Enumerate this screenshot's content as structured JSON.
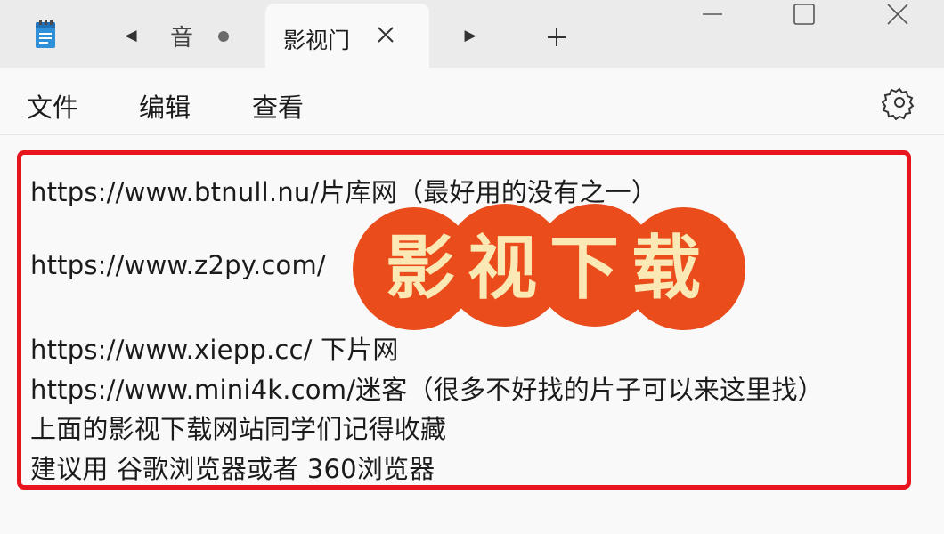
{
  "tabs": {
    "inactive_label": "音",
    "active_label": "影视门"
  },
  "menu": {
    "file": "文件",
    "edit": "编辑",
    "view": "查看"
  },
  "content": {
    "lines": [
      "https://www.btnull.nu/片库网（最好用的没有之一）",
      "",
      "https://www.z2py.com/",
      "",
      "https://www.xiepp.cc/  下片网",
      "https://www.mini4k.com/迷客（很多不好找的片子可以来这里找）",
      "上面的影视下载网站同学们记得收藏",
      "建议用 谷歌浏览器或者 360浏览器"
    ]
  },
  "overlay": {
    "title": "影视下载"
  },
  "colors": {
    "highlight_border": "#e8141e",
    "stamp_fill": "#ea4d1b",
    "stamp_text": "#fbe9b5",
    "titlebar_bg": "#ebebeb"
  },
  "icons": {
    "app": "notepad-icon",
    "tab_prev": "triangle-left-icon",
    "tab_next": "triangle-right-icon",
    "tab_close": "close-icon",
    "new_tab": "plus-icon",
    "settings": "gear-icon",
    "minimize": "minimize-icon",
    "maximize": "maximize-icon",
    "close": "close-icon"
  }
}
